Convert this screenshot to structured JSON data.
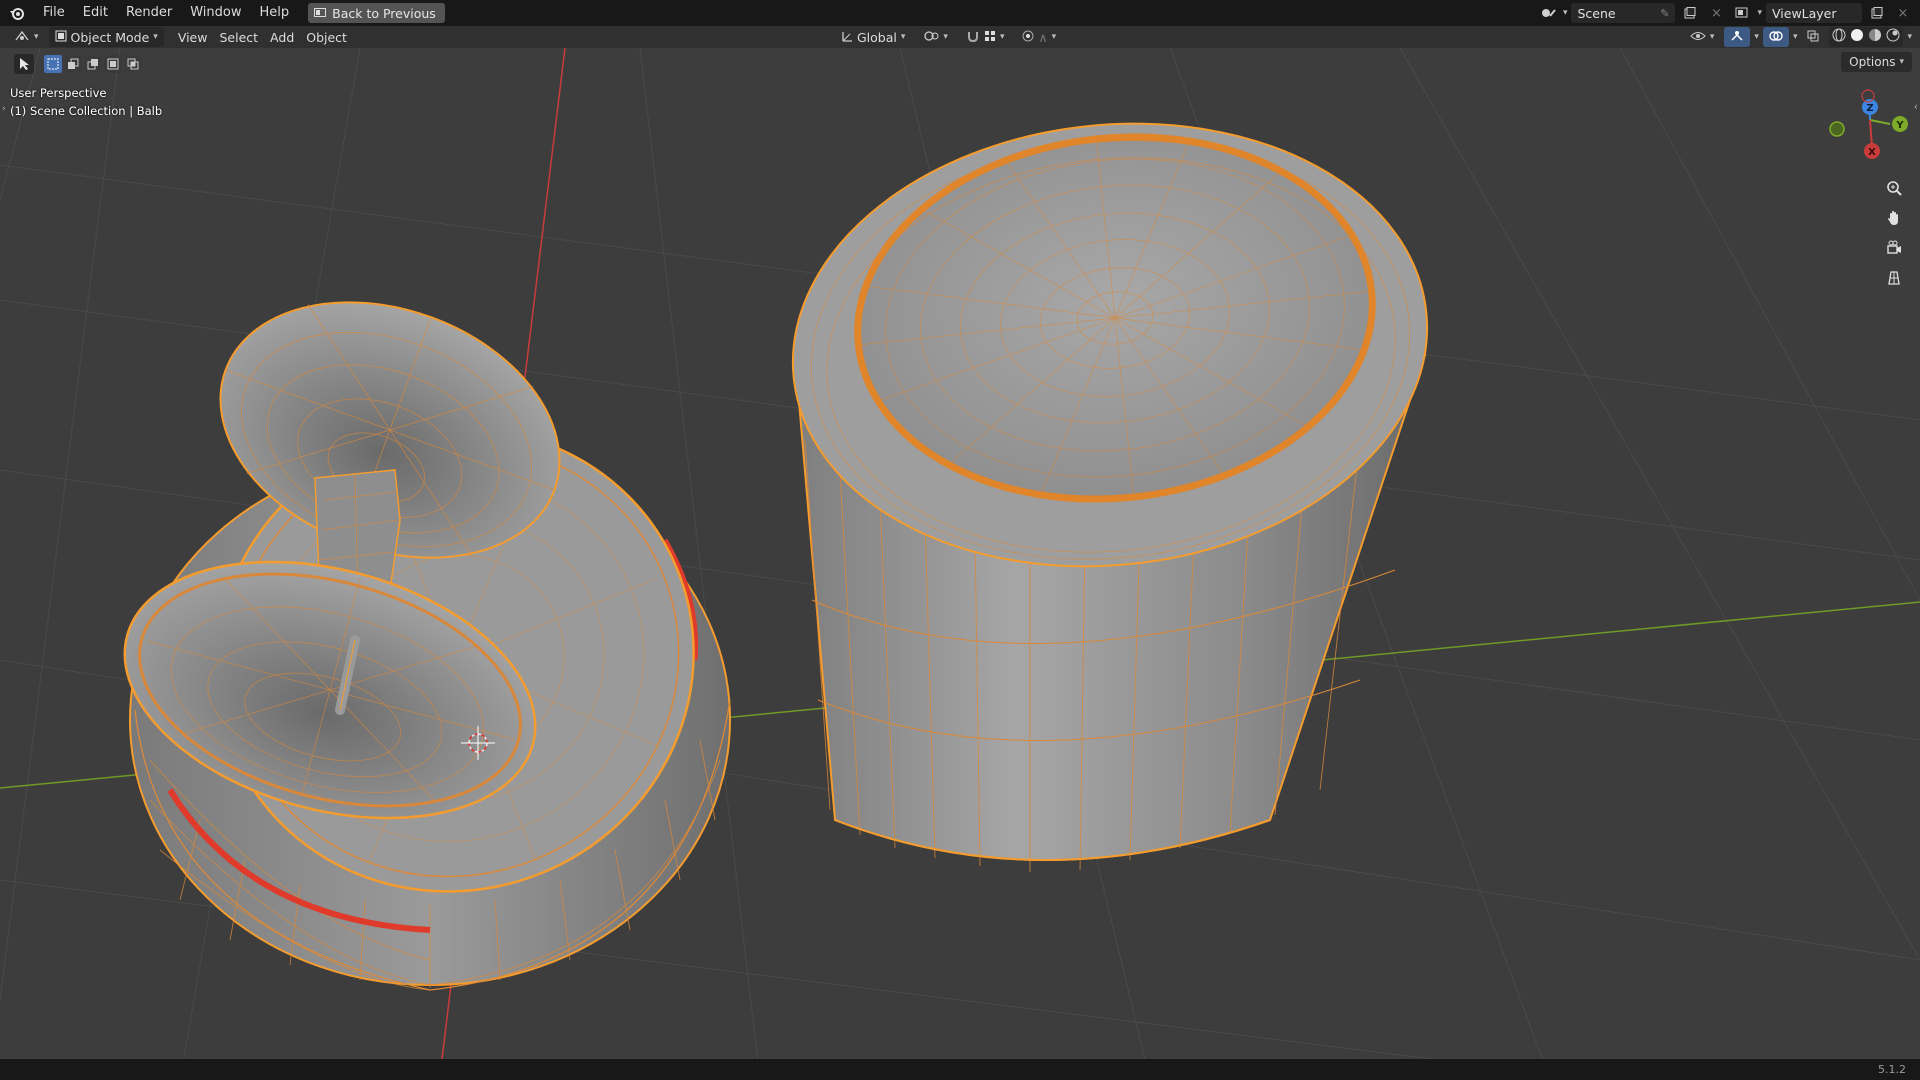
{
  "topbar": {
    "menus": [
      "File",
      "Edit",
      "Render",
      "Window",
      "Help"
    ],
    "back_button": "Back to Previous",
    "scene_name": "Scene",
    "view_layer": "ViewLayer"
  },
  "header": {
    "mode": "Object Mode",
    "menus": [
      "View",
      "Select",
      "Add",
      "Object"
    ],
    "transform_orientation": "Global"
  },
  "viewport": {
    "options_label": "Options",
    "perspective_label": "User Perspective",
    "collection_label": "(1) Scene Collection | Balb",
    "gizmo": {
      "x": "X",
      "y": "Y",
      "z": "Z"
    }
  },
  "status": {
    "version": "5.1.2"
  },
  "colors": {
    "selection_outline": "#f59c2e",
    "x_axis": "#c93c3c",
    "y_axis": "#7fab2a",
    "z_axis": "#3a86e2",
    "mesh_surface": "#9c9c9c"
  }
}
